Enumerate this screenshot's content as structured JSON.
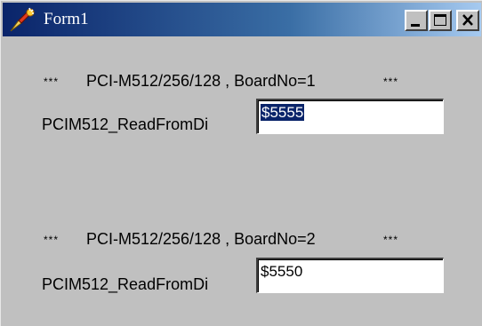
{
  "window": {
    "title": "Form1",
    "icon": "form-app-icon",
    "controls": [
      "minimize-icon",
      "maximize-icon",
      "close-icon"
    ]
  },
  "boards": [
    {
      "prefix": "***",
      "header": "PCI-M512/256/128 , BoardNo=1",
      "suffix": "***",
      "label": "PCIM512_ReadFromDi",
      "value": "$5555",
      "selected": true
    },
    {
      "prefix": "***",
      "header": "PCI-M512/256/128 , BoardNo=2",
      "suffix": "***",
      "label": "PCIM512_ReadFromDi",
      "value": "$5550",
      "selected": false
    }
  ],
  "colors": {
    "face": "#c0c0c0",
    "title_start": "#0a246a",
    "title_end": "#a6caf0",
    "selection": "#0a246a"
  }
}
